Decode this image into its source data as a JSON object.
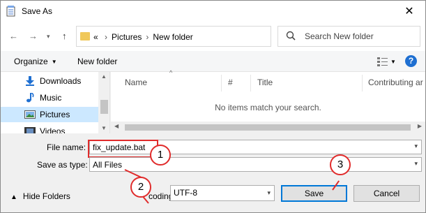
{
  "window": {
    "title": "Save As",
    "close_glyph": "✕"
  },
  "address": {
    "overflow": "«",
    "crumbs": [
      "Pictures",
      "New folder"
    ],
    "separator": "›",
    "search_placeholder": "Search New folder"
  },
  "toolbar": {
    "organize_label": "Organize",
    "new_folder_label": "New folder",
    "help_glyph": "?"
  },
  "navigation": {
    "items": [
      {
        "label": "Downloads",
        "icon": "download-icon",
        "selected": false
      },
      {
        "label": "Music",
        "icon": "music-icon",
        "selected": false
      },
      {
        "label": "Pictures",
        "icon": "pictures-icon",
        "selected": true
      },
      {
        "label": "Videos",
        "icon": "videos-icon",
        "selected": false
      }
    ]
  },
  "file_list": {
    "columns": [
      "Name",
      "#",
      "Title",
      "Contributing ar"
    ],
    "empty_message": "No items match your search."
  },
  "form": {
    "file_name_label": "File name:",
    "file_name_value": "fix_update.bat",
    "save_type_label": "Save as type:",
    "save_type_value": "All Files",
    "encoding_label": "Encoding:",
    "encoding_label_visible": "coding:",
    "encoding_value": "UTF-8"
  },
  "footer": {
    "hide_folders_label": "Hide Folders",
    "save_label": "Save",
    "cancel_label": "Cancel"
  },
  "callouts": [
    "1",
    "2",
    "3"
  ],
  "colors": {
    "accent": "#0078d7",
    "annotation": "#e02b2b",
    "selection": "#cce8ff",
    "folder": "#f0c85a"
  }
}
